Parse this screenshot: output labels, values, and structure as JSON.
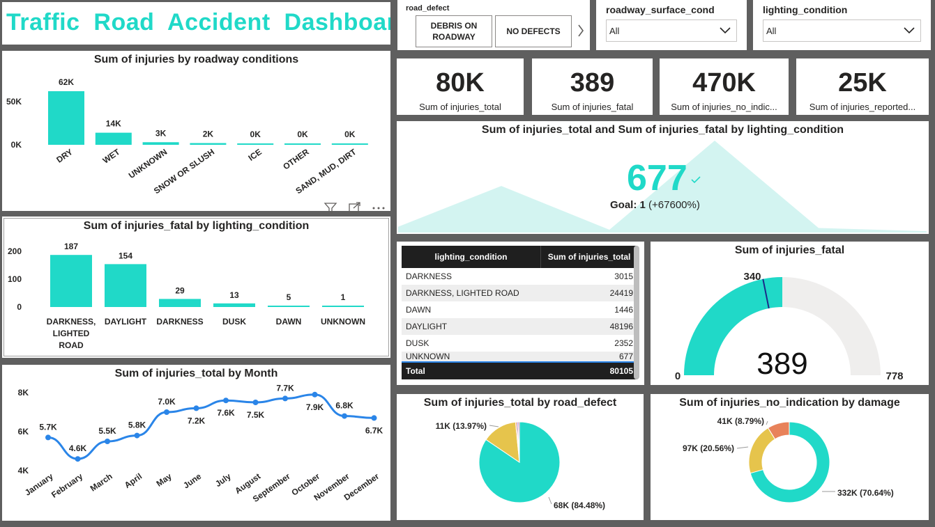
{
  "title": "Traffic  Road  Accident  Dashboard",
  "slicers": {
    "road_defect": {
      "label": "road_defect",
      "chips": [
        "DEBRIS ON ROADWAY",
        "NO DEFECTS"
      ]
    },
    "surface": {
      "label": "roadway_surface_cond",
      "value": "All"
    },
    "lighting": {
      "label": "lighting_condition",
      "value": "All"
    }
  },
  "cards": [
    {
      "value": "80K",
      "label": "Sum of injuries_total"
    },
    {
      "value": "389",
      "label": "Sum of injuries_fatal"
    },
    {
      "value": "470K",
      "label": "Sum of injuries_no_indic..."
    },
    {
      "value": "25K",
      "label": "Sum of injuries_reported..."
    }
  ],
  "kpi": {
    "title": "Sum of injuries_total and Sum of injuries_fatal by lighting_condition",
    "value": "677",
    "goal_label": "Goal:",
    "goal_value": "1",
    "goal_change": "(+67600%)"
  },
  "table": {
    "headers": [
      "lighting_condition",
      "Sum of injuries_total"
    ],
    "rows": [
      [
        "DARKNESS",
        "3015"
      ],
      [
        "DARKNESS, LIGHTED ROAD",
        "24419"
      ],
      [
        "DAWN",
        "1446"
      ],
      [
        "DAYLIGHT",
        "48196"
      ],
      [
        "DUSK",
        "2352"
      ],
      [
        "UNKNOWN",
        "677"
      ]
    ],
    "total": [
      "Total",
      "80105"
    ]
  },
  "colors": {
    "teal": "#20d9c8",
    "blue": "#2a85e8",
    "yellow": "#e6c44c",
    "orange": "#e8825a",
    "gauge_bg": "#efeeed"
  },
  "chart_data": [
    {
      "id": "roadway",
      "type": "bar",
      "title": "Sum of injuries by roadway conditions",
      "categories": [
        "DRY",
        "WET",
        "UNKNOWN",
        "SNOW OR SLUSH",
        "ICE",
        "OTHER",
        "SAND, MUD, DIRT"
      ],
      "values": [
        62000,
        14000,
        3000,
        2000,
        0,
        0,
        0
      ],
      "data_labels": [
        "62K",
        "14K",
        "3K",
        "2K",
        "0K",
        "0K",
        "0K"
      ],
      "yticks": [
        "50K",
        "0K"
      ],
      "ylim": [
        0,
        62000
      ]
    },
    {
      "id": "fatal",
      "type": "bar",
      "title": "Sum of injuries_fatal by lighting_condition",
      "categories": [
        "DARKNESS, LIGHTED ROAD",
        "DAYLIGHT",
        "DARKNESS",
        "DUSK",
        "DAWN",
        "UNKNOWN"
      ],
      "category_lines": [
        [
          "DARKNESS,",
          "LIGHTED",
          "ROAD"
        ],
        [
          "DAYLIGHT"
        ],
        [
          "DARKNESS"
        ],
        [
          "DUSK"
        ],
        [
          "DAWN"
        ],
        [
          "UNKNOWN"
        ]
      ],
      "values": [
        187,
        154,
        29,
        13,
        5,
        1
      ],
      "data_labels": [
        "187",
        "154",
        "29",
        "13",
        "5",
        "1"
      ],
      "yticks": [
        "200",
        "100",
        "0"
      ],
      "ylim": [
        0,
        200
      ]
    },
    {
      "id": "month",
      "type": "line",
      "title": "Sum of injuries_total by Month",
      "categories": [
        "January",
        "February",
        "March",
        "April",
        "May",
        "June",
        "July",
        "August",
        "September",
        "October",
        "November",
        "December"
      ],
      "values": [
        5700,
        4600,
        5500,
        5800,
        7000,
        7200,
        7600,
        7500,
        7700,
        7900,
        6800,
        6700
      ],
      "data_labels": [
        "5.7K",
        "4.6K",
        "5.5K",
        "5.8K",
        "7.0K",
        "7.2K",
        "7.6K",
        "7.5K",
        "7.7K",
        "7.9K",
        "6.8K",
        "6.7K"
      ],
      "yticks": [
        "8K",
        "6K",
        "4K"
      ],
      "ylim": [
        4000,
        8000
      ]
    },
    {
      "id": "area",
      "type": "area",
      "note_values": [
        3015,
        24419,
        1446,
        48196,
        2352,
        677
      ],
      "categories": [
        "DARKNESS",
        "DARKNESS, LIGHTED ROAD",
        "DAWN",
        "DAYLIGHT",
        "DUSK",
        "UNKNOWN"
      ]
    },
    {
      "id": "gauge",
      "type": "gauge",
      "title": "Sum of injuries_fatal",
      "value": 389,
      "min": 0,
      "max": 778,
      "target": 340,
      "labels": {
        "value": "389",
        "min": "0",
        "max": "778",
        "target": "340"
      }
    },
    {
      "id": "pie",
      "type": "pie",
      "title": "Sum of injuries_total by road_defect",
      "slices": [
        {
          "label": "68K (84.48%)",
          "pct": 84.48,
          "color": "#20d9c8"
        },
        {
          "label": "11K (13.97%)",
          "pct": 13.97,
          "color": "#e6c44c"
        },
        {
          "label": "",
          "pct": 0.55,
          "color": "#e8825a"
        },
        {
          "label": "",
          "pct": 0.5,
          "color": "#7b6fd6"
        },
        {
          "label": "",
          "pct": 0.5,
          "color": "#d64c8a"
        }
      ]
    },
    {
      "id": "donut",
      "type": "donut",
      "title": "Sum of injuries_no_indication by damage",
      "slices": [
        {
          "label": "332K (70.64%)",
          "pct": 70.64,
          "color": "#20d9c8"
        },
        {
          "label": "97K (20.56%)",
          "pct": 20.56,
          "color": "#e6c44c"
        },
        {
          "label": "41K (8.79%)",
          "pct": 8.79,
          "color": "#e8825a"
        }
      ]
    }
  ]
}
